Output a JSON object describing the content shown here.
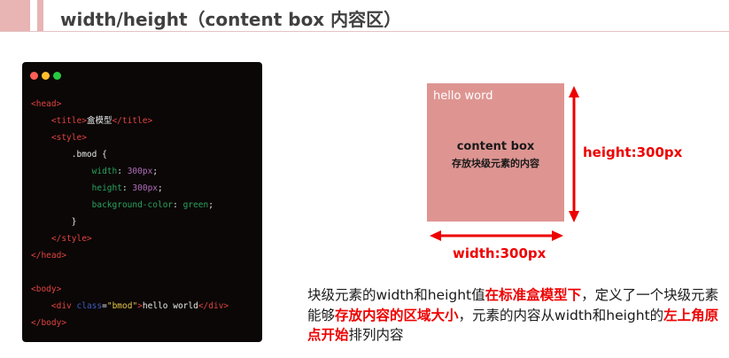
{
  "header": {
    "title": "width/height（content box 内容区）"
  },
  "code": {
    "lines": [
      [
        {
          "t": "<head>",
          "c": "tag"
        }
      ],
      [
        {
          "t": "    "
        },
        {
          "t": "<title>",
          "c": "tag"
        },
        {
          "t": "盒模型",
          "c": "plain"
        },
        {
          "t": "</title>",
          "c": "tag"
        }
      ],
      [
        {
          "t": "    "
        },
        {
          "t": "<style>",
          "c": "tag"
        }
      ],
      [
        {
          "t": "        .bmod {",
          "c": "plain"
        }
      ],
      [
        {
          "t": "            "
        },
        {
          "t": "width",
          "c": "kw"
        },
        {
          "t": ": ",
          "c": "plain"
        },
        {
          "t": "300px",
          "c": "num"
        },
        {
          "t": ";",
          "c": "plain"
        }
      ],
      [
        {
          "t": "            "
        },
        {
          "t": "height",
          "c": "kw"
        },
        {
          "t": ": ",
          "c": "plain"
        },
        {
          "t": "300px",
          "c": "num"
        },
        {
          "t": ";",
          "c": "plain"
        }
      ],
      [
        {
          "t": "            "
        },
        {
          "t": "background-color",
          "c": "kw"
        },
        {
          "t": ": ",
          "c": "plain"
        },
        {
          "t": "green",
          "c": "kw"
        },
        {
          "t": ";",
          "c": "plain"
        }
      ],
      [
        {
          "t": "        }",
          "c": "plain"
        }
      ],
      [
        {
          "t": "    "
        },
        {
          "t": "</style>",
          "c": "tag"
        }
      ],
      [
        {
          "t": "</head>",
          "c": "tag"
        }
      ],
      [],
      [
        {
          "t": "<body>",
          "c": "tag"
        }
      ],
      [
        {
          "t": "    "
        },
        {
          "t": "<div ",
          "c": "tag"
        },
        {
          "t": "class",
          "c": "attr"
        },
        {
          "t": "=",
          "c": "plain"
        },
        {
          "t": "\"bmod\"",
          "c": "str"
        },
        {
          "t": ">",
          "c": "tag"
        },
        {
          "t": "hello world",
          "c": "plain"
        },
        {
          "t": "</div>",
          "c": "tag"
        }
      ],
      [
        {
          "t": "</body>",
          "c": "tag"
        }
      ]
    ]
  },
  "diagram": {
    "box_text": "hello word",
    "box_label_1": "content box",
    "box_label_2": "存放块级元素的内容",
    "height_label": "height:300px",
    "width_label": "width:300px",
    "accent_color": "#ee0000",
    "box_color": "#de9592"
  },
  "description": {
    "segments": [
      {
        "t": "块级元素的width和height值",
        "hl": false
      },
      {
        "t": "在标准盒模型下",
        "hl": true
      },
      {
        "t": "，定义了一个块级元素能够",
        "hl": false
      },
      {
        "t": "存放内容的区域大小",
        "hl": true
      },
      {
        "t": "，元素的内容从width和height的",
        "hl": false
      },
      {
        "t": "左上角原点开始",
        "hl": true
      },
      {
        "t": "排列内容",
        "hl": false
      }
    ]
  }
}
